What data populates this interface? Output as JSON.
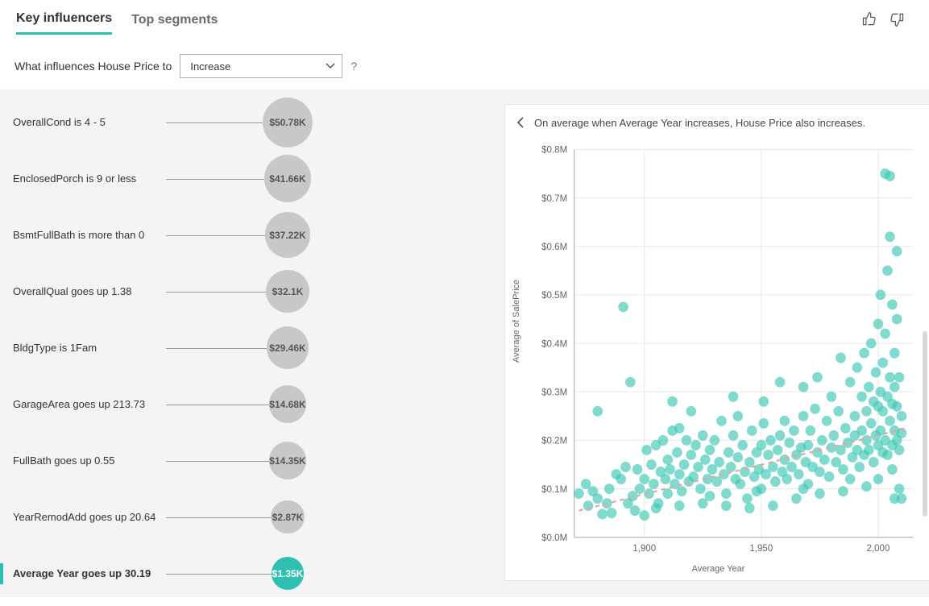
{
  "tabs": {
    "key_influencers": "Key influencers",
    "top_segments": "Top segments"
  },
  "question": {
    "text": "What influences House Price to",
    "select_value": "Increase",
    "help": "?"
  },
  "influencers": [
    {
      "label": "OverallCond is 4 - 5",
      "value": "$50.78K",
      "num": 50.78,
      "selected": false
    },
    {
      "label": "EnclosedPorch is 9 or less",
      "value": "$41.66K",
      "num": 41.66,
      "selected": false
    },
    {
      "label": "BsmtFullBath is more than 0",
      "value": "$37.22K",
      "num": 37.22,
      "selected": false
    },
    {
      "label": "OverallQual goes up 1.38",
      "value": "$32.1K",
      "num": 32.1,
      "selected": false
    },
    {
      "label": "BldgType is 1Fam",
      "value": "$29.46K",
      "num": 29.46,
      "selected": false
    },
    {
      "label": "GarageArea goes up 213.73",
      "value": "$14.68K",
      "num": 14.68,
      "selected": false
    },
    {
      "label": "FullBath goes up 0.55",
      "value": "$14.35K",
      "num": 14.35,
      "selected": false
    },
    {
      "label": "YearRemodAdd goes up 20.64",
      "value": "$2.87K",
      "num": 2.87,
      "selected": false
    },
    {
      "label": "Average Year goes up 30.19",
      "value": "$1.35K",
      "num": 1.35,
      "selected": true
    }
  ],
  "panel": {
    "title": "On average when Average Year increases, House Price also increases."
  },
  "chart_data": {
    "type": "scatter",
    "title": "",
    "xlabel": "Average Year",
    "ylabel": "Average of SalePrice",
    "xlim": [
      1870,
      2015
    ],
    "ylim": [
      0,
      0.8
    ],
    "xticks": [
      1900,
      1950,
      2000
    ],
    "yticks": [
      0.0,
      0.1,
      0.2,
      0.3,
      0.4,
      0.5,
      0.6,
      0.7,
      0.8
    ],
    "ytick_labels": [
      "$0.0M",
      "$0.1M",
      "$0.2M",
      "$0.3M",
      "$0.4M",
      "$0.5M",
      "$0.6M",
      "$0.7M",
      "$0.8M"
    ],
    "trend_line": {
      "x1": 1872,
      "y1": 0.055,
      "x2": 2012,
      "y2": 0.225
    },
    "note": "dense point cloud — values below are representative points read approximately from the figure",
    "points": [
      [
        1872,
        0.09
      ],
      [
        1875,
        0.11
      ],
      [
        1876,
        0.065
      ],
      [
        1878,
        0.095
      ],
      [
        1880,
        0.26
      ],
      [
        1880,
        0.08
      ],
      [
        1882,
        0.048
      ],
      [
        1884,
        0.07
      ],
      [
        1885,
        0.1
      ],
      [
        1886,
        0.05
      ],
      [
        1888,
        0.13
      ],
      [
        1890,
        0.12
      ],
      [
        1891,
        0.475
      ],
      [
        1892,
        0.145
      ],
      [
        1893,
        0.07
      ],
      [
        1894,
        0.32
      ],
      [
        1895,
        0.085
      ],
      [
        1896,
        0.055
      ],
      [
        1897,
        0.14
      ],
      [
        1898,
        0.1
      ],
      [
        1900,
        0.12
      ],
      [
        1900,
        0.045
      ],
      [
        1901,
        0.18
      ],
      [
        1902,
        0.09
      ],
      [
        1903,
        0.15
      ],
      [
        1904,
        0.11
      ],
      [
        1905,
        0.19
      ],
      [
        1906,
        0.07
      ],
      [
        1907,
        0.135
      ],
      [
        1908,
        0.2
      ],
      [
        1909,
        0.12
      ],
      [
        1910,
        0.16
      ],
      [
        1910,
        0.09
      ],
      [
        1911,
        0.14
      ],
      [
        1912,
        0.22
      ],
      [
        1913,
        0.11
      ],
      [
        1914,
        0.175
      ],
      [
        1915,
        0.13
      ],
      [
        1915,
        0.225
      ],
      [
        1916,
        0.095
      ],
      [
        1917,
        0.15
      ],
      [
        1918,
        0.2
      ],
      [
        1919,
        0.115
      ],
      [
        1920,
        0.17
      ],
      [
        1920,
        0.26
      ],
      [
        1921,
        0.125
      ],
      [
        1922,
        0.19
      ],
      [
        1923,
        0.145
      ],
      [
        1924,
        0.1
      ],
      [
        1925,
        0.21
      ],
      [
        1926,
        0.16
      ],
      [
        1927,
        0.12
      ],
      [
        1928,
        0.18
      ],
      [
        1929,
        0.14
      ],
      [
        1930,
        0.2
      ],
      [
        1931,
        0.115
      ],
      [
        1932,
        0.155
      ],
      [
        1933,
        0.24
      ],
      [
        1934,
        0.13
      ],
      [
        1935,
        0.09
      ],
      [
        1936,
        0.175
      ],
      [
        1937,
        0.145
      ],
      [
        1938,
        0.21
      ],
      [
        1939,
        0.12
      ],
      [
        1940,
        0.165
      ],
      [
        1940,
        0.25
      ],
      [
        1941,
        0.11
      ],
      [
        1942,
        0.19
      ],
      [
        1943,
        0.135
      ],
      [
        1944,
        0.08
      ],
      [
        1945,
        0.155
      ],
      [
        1946,
        0.22
      ],
      [
        1947,
        0.125
      ],
      [
        1948,
        0.175
      ],
      [
        1949,
        0.14
      ],
      [
        1950,
        0.1
      ],
      [
        1950,
        0.19
      ],
      [
        1951,
        0.28
      ],
      [
        1951,
        0.235
      ],
      [
        1952,
        0.13
      ],
      [
        1953,
        0.17
      ],
      [
        1954,
        0.2
      ],
      [
        1955,
        0.145
      ],
      [
        1956,
        0.115
      ],
      [
        1957,
        0.18
      ],
      [
        1958,
        0.21
      ],
      [
        1959,
        0.135
      ],
      [
        1960,
        0.16
      ],
      [
        1960,
        0.24
      ],
      [
        1961,
        0.12
      ],
      [
        1962,
        0.195
      ],
      [
        1963,
        0.145
      ],
      [
        1964,
        0.22
      ],
      [
        1965,
        0.17
      ],
      [
        1966,
        0.13
      ],
      [
        1967,
        0.185
      ],
      [
        1968,
        0.31
      ],
      [
        1968,
        0.25
      ],
      [
        1969,
        0.155
      ],
      [
        1970,
        0.19
      ],
      [
        1970,
        0.11
      ],
      [
        1971,
        0.22
      ],
      [
        1972,
        0.145
      ],
      [
        1973,
        0.265
      ],
      [
        1974,
        0.175
      ],
      [
        1975,
        0.135
      ],
      [
        1976,
        0.2
      ],
      [
        1977,
        0.16
      ],
      [
        1978,
        0.24
      ],
      [
        1979,
        0.125
      ],
      [
        1980,
        0.185
      ],
      [
        1980,
        0.29
      ],
      [
        1981,
        0.21
      ],
      [
        1982,
        0.155
      ],
      [
        1983,
        0.26
      ],
      [
        1984,
        0.18
      ],
      [
        1985,
        0.14
      ],
      [
        1986,
        0.225
      ],
      [
        1987,
        0.195
      ],
      [
        1988,
        0.32
      ],
      [
        1989,
        0.165
      ],
      [
        1990,
        0.25
      ],
      [
        1990,
        0.21
      ],
      [
        1991,
        0.18
      ],
      [
        1991,
        0.35
      ],
      [
        1992,
        0.145
      ],
      [
        1993,
        0.29
      ],
      [
        1993,
        0.22
      ],
      [
        1994,
        0.17
      ],
      [
        1994,
        0.38
      ],
      [
        1995,
        0.26
      ],
      [
        1995,
        0.2
      ],
      [
        1996,
        0.31
      ],
      [
        1996,
        0.18
      ],
      [
        1997,
        0.235
      ],
      [
        1997,
        0.4
      ],
      [
        1998,
        0.155
      ],
      [
        1998,
        0.28
      ],
      [
        1999,
        0.34
      ],
      [
        1999,
        0.21
      ],
      [
        2000,
        0.19
      ],
      [
        2000,
        0.27
      ],
      [
        2000,
        0.44
      ],
      [
        2000,
        0.12
      ],
      [
        2001,
        0.3
      ],
      [
        2001,
        0.22
      ],
      [
        2001,
        0.5
      ],
      [
        2002,
        0.175
      ],
      [
        2002,
        0.26
      ],
      [
        2002,
        0.36
      ],
      [
        2003,
        0.42
      ],
      [
        2003,
        0.2
      ],
      [
        2003,
        0.75
      ],
      [
        2004,
        0.29
      ],
      [
        2004,
        0.17
      ],
      [
        2004,
        0.55
      ],
      [
        2005,
        0.33
      ],
      [
        2005,
        0.62
      ],
      [
        2005,
        0.24
      ],
      [
        2005,
        0.745
      ],
      [
        2006,
        0.19
      ],
      [
        2006,
        0.275
      ],
      [
        2006,
        0.48
      ],
      [
        2006,
        0.14
      ],
      [
        2007,
        0.31
      ],
      [
        2007,
        0.22
      ],
      [
        2007,
        0.38
      ],
      [
        2007,
        0.08
      ],
      [
        2008,
        0.45
      ],
      [
        2008,
        0.2
      ],
      [
        2008,
        0.27
      ],
      [
        2008,
        0.59
      ],
      [
        2009,
        0.18
      ],
      [
        2009,
        0.33
      ],
      [
        2009,
        0.1
      ],
      [
        2010,
        0.25
      ],
      [
        2010,
        0.215
      ],
      [
        2010,
        0.08
      ],
      [
        1905,
        0.06
      ],
      [
        1915,
        0.065
      ],
      [
        1925,
        0.07
      ],
      [
        1935,
        0.065
      ],
      [
        1945,
        0.06
      ],
      [
        1955,
        0.065
      ],
      [
        1965,
        0.08
      ],
      [
        1975,
        0.09
      ],
      [
        1985,
        0.095
      ],
      [
        1995,
        0.105
      ],
      [
        1912,
        0.28
      ],
      [
        1938,
        0.29
      ],
      [
        1958,
        0.32
      ],
      [
        1974,
        0.33
      ],
      [
        1984,
        0.37
      ],
      [
        1928,
        0.085
      ],
      [
        1948,
        0.095
      ],
      [
        1968,
        0.1
      ],
      [
        1988,
        0.12
      ]
    ]
  }
}
